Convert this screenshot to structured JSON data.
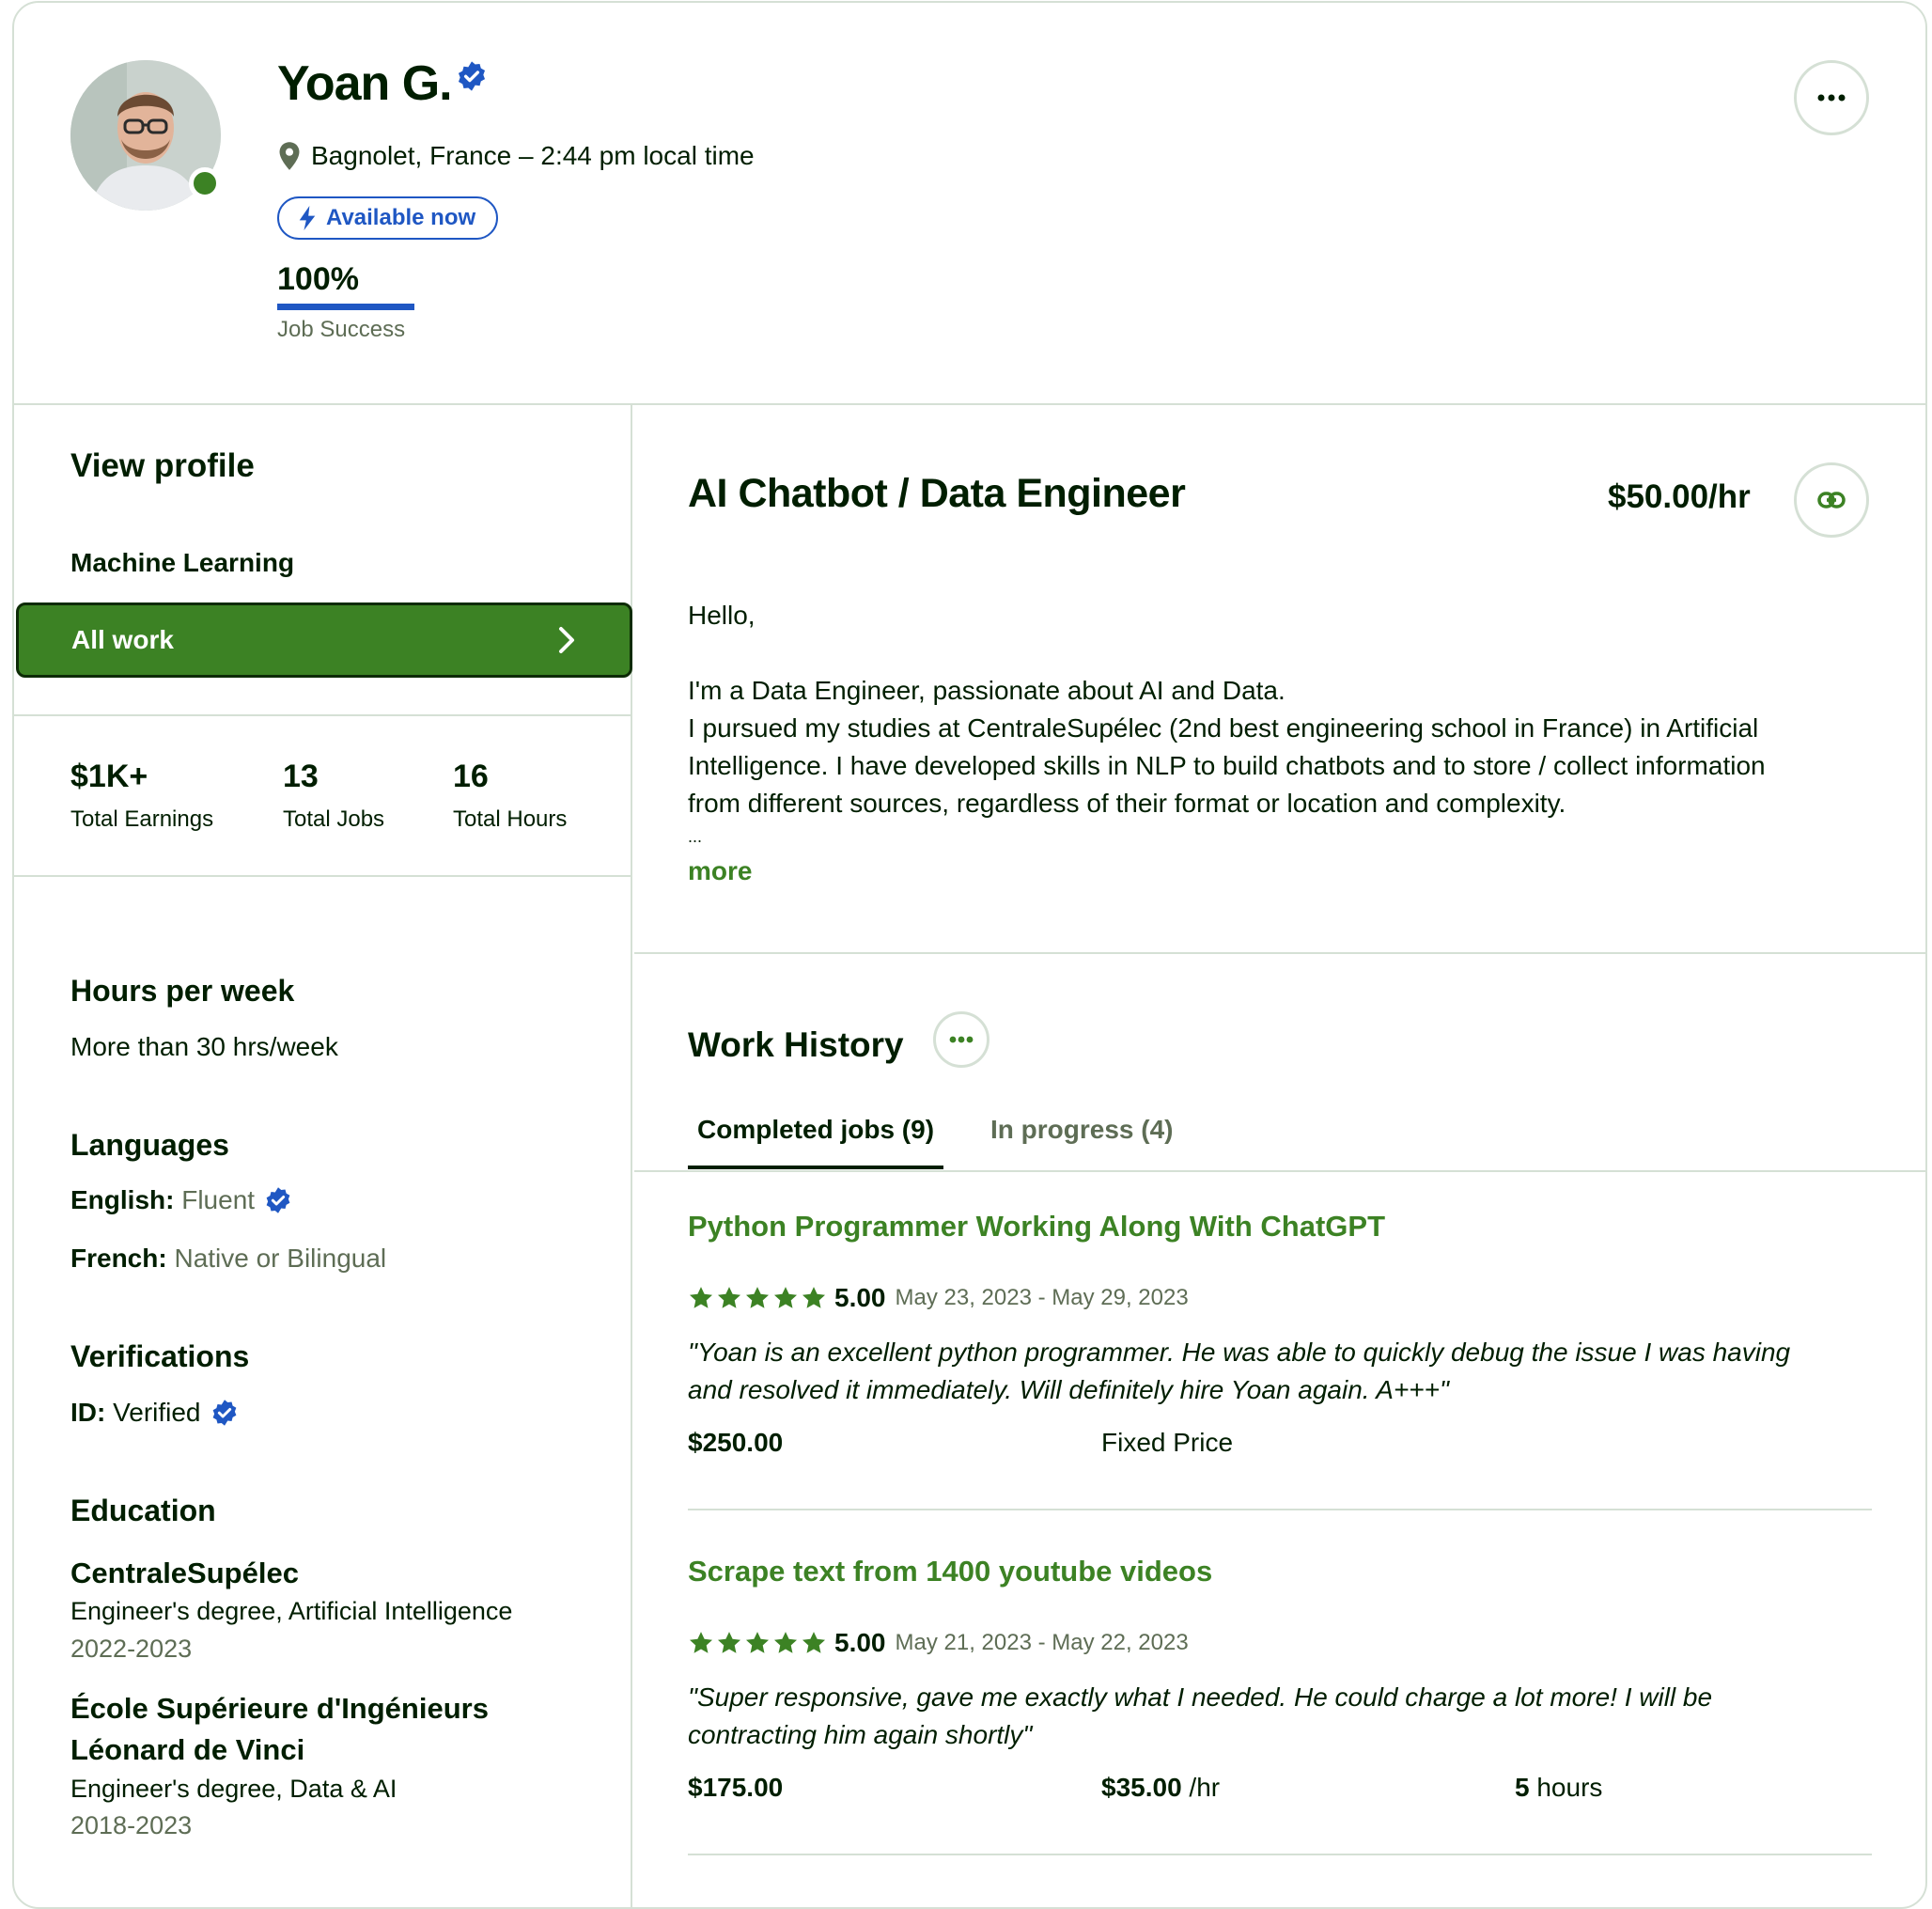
{
  "profile": {
    "name": "Yoan G.",
    "location": "Bagnolet, France – 2:44 pm local time",
    "availability": "Available now",
    "job_success_value": "100%",
    "job_success_percent": 100,
    "job_success_label": "Job Success"
  },
  "sidebar": {
    "view_profile": "View profile",
    "specialized_profile": "Machine Learning",
    "all_work": "All work",
    "stats": [
      {
        "value": "$1K+",
        "label": "Total Earnings"
      },
      {
        "value": "13",
        "label": "Total Jobs"
      },
      {
        "value": "16",
        "label": "Total Hours"
      }
    ],
    "hours_title": "Hours per week",
    "hours_value": "More than 30 hrs/week",
    "languages_title": "Languages",
    "languages": [
      {
        "name": "English:",
        "level": "Fluent",
        "verified": true
      },
      {
        "name": "French:",
        "level": "Native or Bilingual",
        "verified": false
      }
    ],
    "verifications_title": "Verifications",
    "id_label": "ID:",
    "id_value": "Verified",
    "education_title": "Education",
    "education": [
      {
        "school": "CentraleSupélec",
        "degree": "Engineer's degree, Artificial Intelligence",
        "years": "2022-2023"
      },
      {
        "school_line1": "École Supérieure d'Ingénieurs",
        "school_line2": "Léonard de Vinci",
        "degree": "Engineer's degree, Data & AI",
        "years": "2018-2023"
      }
    ]
  },
  "main": {
    "title": "AI Chatbot / Data Engineer",
    "rate": "$50.00/hr",
    "overview_greeting": "Hello,",
    "overview_lines": [
      "I'm a Data Engineer, passionate about AI and Data.",
      "I pursued my studies at CentraleSupélec (2nd best engineering school in France) in Artificial",
      "Intelligence. I have developed skills in NLP to build chatbots and to store / collect information",
      "from different sources, regardless of their format or location and complexity."
    ],
    "overview_ellipsis": "...",
    "more": "more",
    "work_history_title": "Work History",
    "tabs": [
      {
        "label": "Completed jobs (9)",
        "active": true
      },
      {
        "label": "In progress (4)",
        "active": false
      }
    ],
    "jobs": [
      {
        "title": "Python Programmer Working Along With ChatGPT",
        "rating": "5.00",
        "stars": 5,
        "dates": "May 23, 2023 - May 29, 2023",
        "feedback_line1": "\"Yoan is an excellent python programmer. He was able to quickly debug the issue I was having",
        "feedback_line2": "and resolved it immediately. Will definitely hire Yoan again. A+++\"",
        "amount": "$250.00",
        "type": "Fixed Price"
      },
      {
        "title": "Scrape text from 1400 youtube videos",
        "rating": "5.00",
        "stars": 5,
        "dates": "May 21, 2023 - May 22, 2023",
        "feedback_line1": "\"Super responsive, gave me exactly what I needed. He could charge a lot more! I will be",
        "feedback_line2": "contracting him again shortly\"",
        "amount": "$175.00",
        "hourly_rate": "$35.00",
        "hourly_unit": "/hr",
        "hours_value": "5",
        "hours_unit": "hours"
      }
    ]
  },
  "colors": {
    "brand_green": "#3c8224",
    "verified_blue": "#1f57c3",
    "text": "#001e00",
    "muted": "#5e6d55",
    "border": "#d5e0d5"
  },
  "icons": [
    "verified-badge-icon",
    "location-pin-icon",
    "lightning-icon",
    "more-dots-icon",
    "chevron-right-icon",
    "link-icon",
    "star-icon"
  ]
}
